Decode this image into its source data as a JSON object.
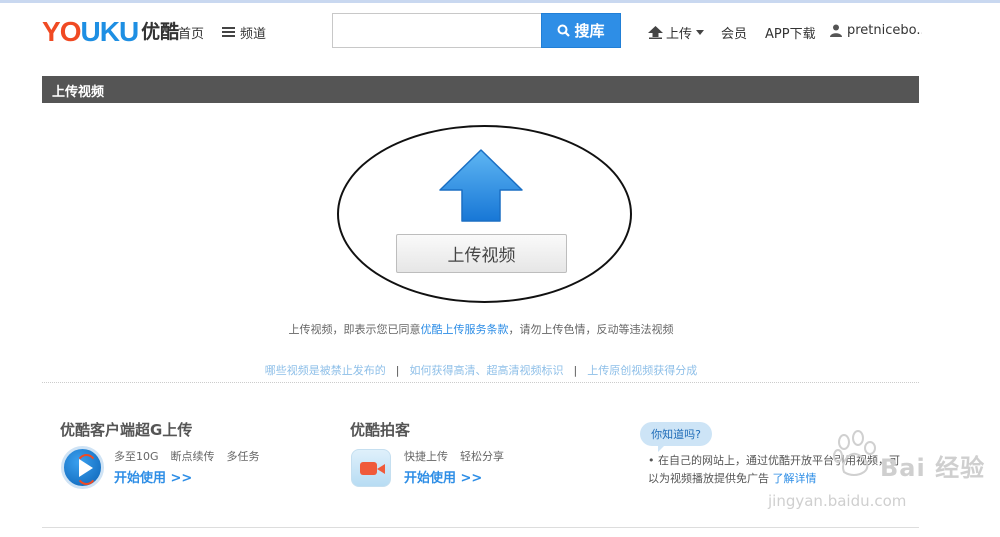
{
  "header": {
    "logo_en": "YOUKU",
    "logo_cn": "优酷",
    "nav_home": "首页",
    "nav_channel": "频道",
    "search_value": "",
    "search_button": "搜库",
    "upload": "上传",
    "vip": "会员",
    "app": "APP下载",
    "user": "pretnicebo.."
  },
  "section": {
    "title": "上传视频"
  },
  "upload": {
    "button_label": "上传视频",
    "terms_prefix": "上传视频，即表示您已同意",
    "terms_link": "优酷上传服务条款",
    "terms_suffix": "，请勿上传色情，反动等违法视频"
  },
  "links": [
    "哪些视频是被禁止发布的",
    "如何获得高清、超高清视频标识",
    "上传原创视频获得分成"
  ],
  "link_separator": "|",
  "features": {
    "client": {
      "title": "优酷客户端超G上传",
      "tags": [
        "多至10G",
        "断点续传",
        "多任务"
      ],
      "cta": "开始使用 >>"
    },
    "camera": {
      "title": "优酷拍客",
      "tags": [
        "快捷上传",
        "轻松分享"
      ],
      "cta": "开始使用 >>"
    }
  },
  "tip": {
    "bubble": "你知道吗?",
    "line1": "• 在自己的网站上，通过优酷开放平台引用视频，可",
    "line2": "以为视频播放提供免广告",
    "link": "了解详情"
  },
  "watermark": {
    "main": "Bai 经验",
    "url": "jingyan.baidu.com"
  },
  "colors": {
    "accent_blue": "#2e8ee6",
    "section_bar": "#555555",
    "logo_red": "#f04a23"
  }
}
